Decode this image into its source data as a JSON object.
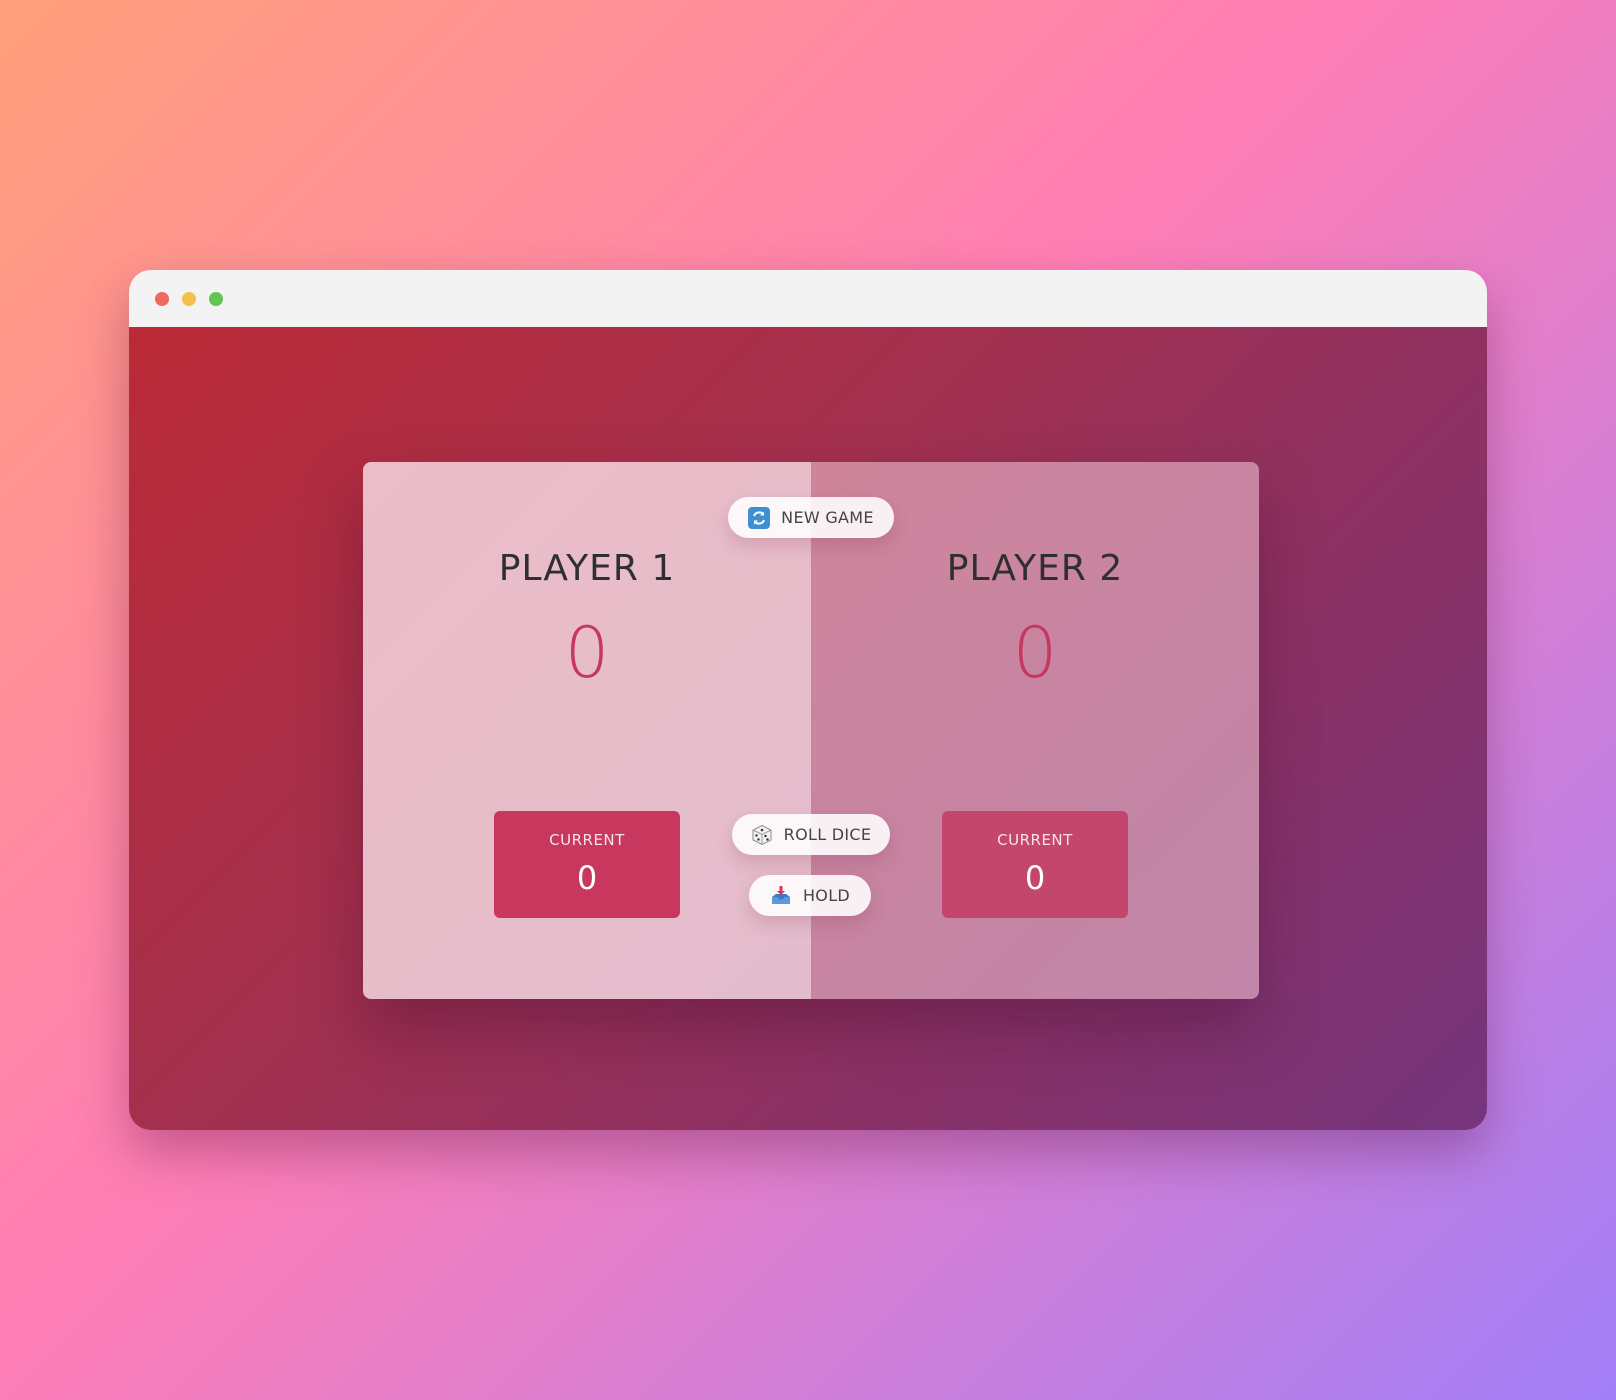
{
  "window": {
    "controls": [
      "close",
      "minimize",
      "maximize"
    ]
  },
  "game": {
    "players": [
      {
        "name": "PLAYER 1",
        "score": "0",
        "current_label": "CURRENT",
        "current_value": "0"
      },
      {
        "name": "PLAYER 2",
        "score": "0",
        "current_label": "CURRENT",
        "current_value": "0"
      }
    ],
    "buttons": {
      "new_game": {
        "label": "NEW GAME",
        "icon": "refresh-icon"
      },
      "roll_dice": {
        "label": "ROLL DICE",
        "icon": "dice-icon"
      },
      "hold": {
        "label": "HOLD",
        "icon": "inbox-tray-icon"
      }
    }
  },
  "colors": {
    "score": "#c7375f",
    "current_box_active": "#c7375e",
    "current_box_inactive": "#c5466c"
  }
}
